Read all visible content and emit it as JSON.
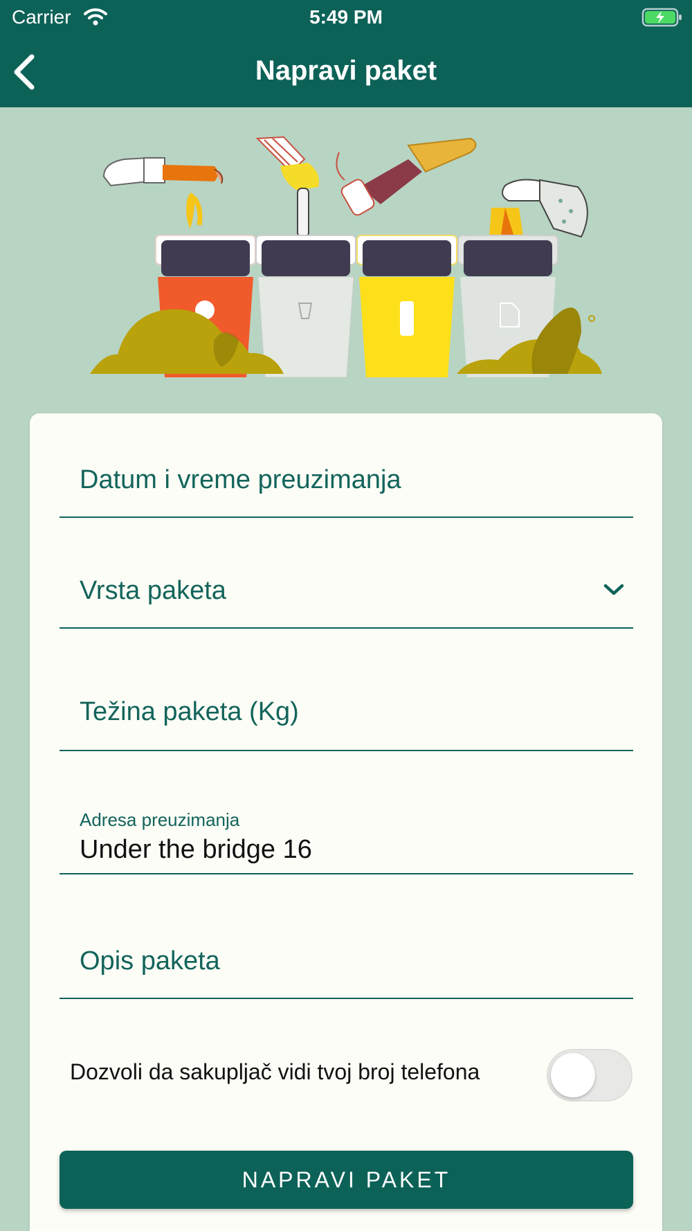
{
  "status_bar": {
    "carrier": "Carrier",
    "time": "5:49 PM",
    "wifi_icon": "wifi-icon",
    "battery_icon": "battery-charging-icon"
  },
  "nav": {
    "title": "Napravi paket",
    "back_icon": "chevron-left-icon"
  },
  "hero": {
    "illustration": "recycling-bins-illustration",
    "bins": [
      "organic-bin",
      "glass-bin",
      "plastic-bin",
      "paper-bin"
    ]
  },
  "form": {
    "pickup_datetime": {
      "placeholder": "Datum i vreme preuzimanja",
      "value": ""
    },
    "package_type": {
      "placeholder": "Vrsta paketa",
      "value": "",
      "icon": "chevron-down-icon"
    },
    "package_weight": {
      "placeholder": "Težina paketa (Kg)",
      "value": ""
    },
    "pickup_address": {
      "label": "Adresa preuzimanja",
      "value": "Under the bridge 16"
    },
    "package_description": {
      "placeholder": "Opis paketa",
      "value": ""
    },
    "phone_toggle": {
      "label": "Dozvoli da sakupljač vidi tvoj broj telefona",
      "on": false
    },
    "submit_label": "NAPRAVI PAKET"
  },
  "colors": {
    "primary": "#0d6258",
    "background": "#b8d4c3",
    "card": "#fcfdf6"
  }
}
